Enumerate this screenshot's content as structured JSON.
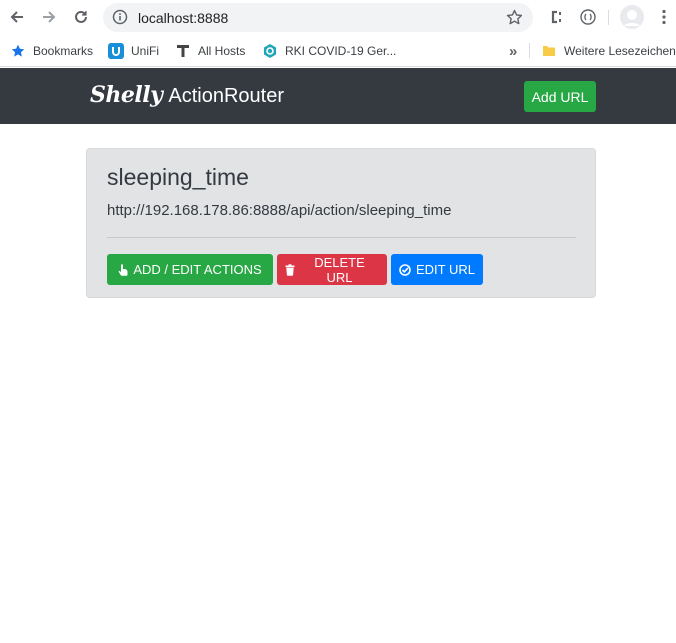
{
  "browser": {
    "address": "localhost:8888",
    "bookmarks": [
      {
        "label": "Bookmarks",
        "icon": "star-icon"
      },
      {
        "label": "UniFi",
        "icon": "unifi-icon"
      },
      {
        "label": "All Hosts",
        "icon": "t-logo-icon"
      },
      {
        "label": "RKI COVID-19 Ger...",
        "icon": "rki-icon"
      }
    ],
    "more_chevron": "»",
    "other_bookmarks": "Weitere Lesezeichen"
  },
  "navbar": {
    "logo": "Shelly",
    "title": "ActionRouter",
    "add_url": "Add URL"
  },
  "card": {
    "title": "sleeping_time",
    "url": "http://192.168.178.86:8888/api/action/sleeping_time",
    "buttons": {
      "add_edit": "ADD / EDIT ACTIONS",
      "delete": "DELETE URL",
      "edit": "EDIT URL"
    }
  },
  "colors": {
    "navbar": "#343a40",
    "success": "#28a745",
    "danger": "#dc3545",
    "primary": "#007bff",
    "card": "#e2e3e5"
  }
}
